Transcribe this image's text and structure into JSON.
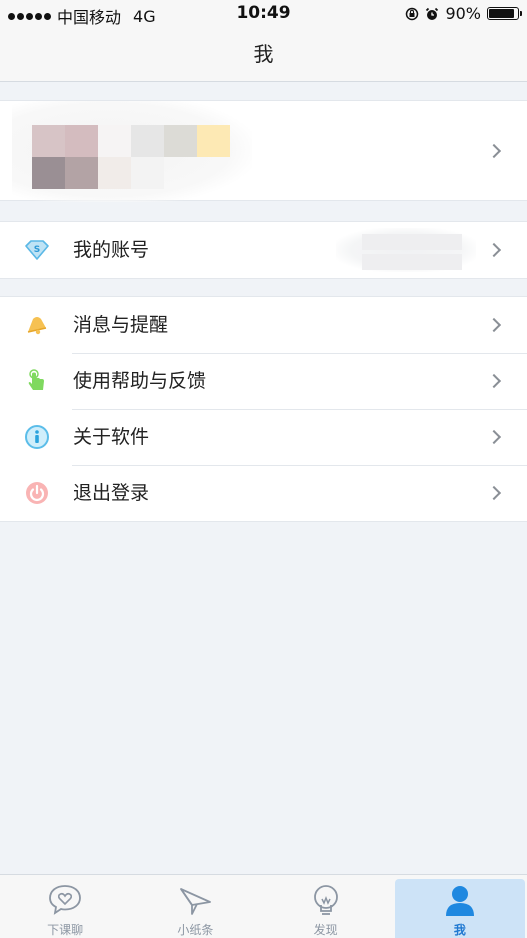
{
  "status_bar": {
    "carrier": "中国移动",
    "network": "4G",
    "time": "10:49",
    "battery_percent": "90%",
    "battery_level": 0.9
  },
  "nav": {
    "title": "我"
  },
  "account_row": {
    "label": "我的账号",
    "icon": "diamond-s-icon"
  },
  "menu": {
    "notifications": {
      "label": "消息与提醒",
      "icon": "bell-icon"
    },
    "help": {
      "label": "使用帮助与反馈",
      "icon": "hand-pointer-icon"
    },
    "about": {
      "label": "关于软件",
      "icon": "info-icon"
    },
    "logout": {
      "label": "退出登录",
      "icon": "power-icon"
    }
  },
  "tabs": [
    {
      "label": "下课聊",
      "icon": "chat-heart-icon",
      "active": false
    },
    {
      "label": "小纸条",
      "icon": "paper-plane-icon",
      "active": false
    },
    {
      "label": "发现",
      "icon": "lightbulb-icon",
      "active": false
    },
    {
      "label": "我",
      "icon": "person-icon",
      "active": true
    }
  ],
  "colors": {
    "accent": "#1f78d1",
    "active_tab_bg": "#cde3f7",
    "background": "#f0f3f7"
  }
}
